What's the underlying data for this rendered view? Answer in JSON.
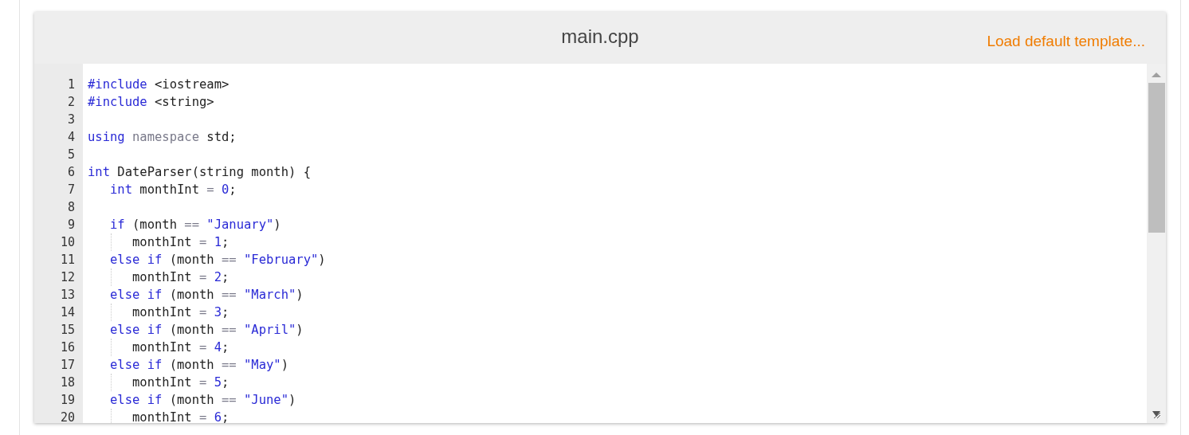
{
  "editor": {
    "title": "main.cpp",
    "template_link": "Load default template...",
    "lines": [
      {
        "number": "1",
        "guide": false,
        "tokens": [
          {
            "kind": "keyword",
            "text": "#include"
          },
          {
            "kind": "plain",
            "text": " <iostream>"
          }
        ]
      },
      {
        "number": "2",
        "guide": false,
        "tokens": [
          {
            "kind": "keyword",
            "text": "#include"
          },
          {
            "kind": "plain",
            "text": " <string>"
          }
        ]
      },
      {
        "number": "3",
        "guide": false
      },
      {
        "number": "4",
        "guide": false,
        "tokens": [
          {
            "kind": "keyword",
            "text": "using"
          },
          {
            "kind": "muted",
            "text": " namespace"
          },
          {
            "kind": "plain",
            "text": " std;"
          }
        ]
      },
      {
        "number": "5",
        "guide": false
      },
      {
        "number": "6",
        "guide": false,
        "tokens": [
          {
            "kind": "keyword",
            "text": "int"
          },
          {
            "kind": "plain",
            "text": " DateParser(string month) {"
          }
        ]
      },
      {
        "number": "7",
        "guide": false,
        "tokens": [
          {
            "kind": "keyword",
            "text": "   int"
          },
          {
            "kind": "plain",
            "text": " monthInt "
          },
          {
            "kind": "muted",
            "text": "="
          },
          {
            "kind": "literal",
            "text": " 0"
          },
          {
            "kind": "plain",
            "text": ";"
          }
        ]
      },
      {
        "number": "8",
        "guide": false
      },
      {
        "number": "9",
        "guide": false,
        "tokens": [
          {
            "kind": "keyword",
            "text": "   if"
          },
          {
            "kind": "plain",
            "text": " (month "
          },
          {
            "kind": "muted",
            "text": "=="
          },
          {
            "kind": "literal",
            "text": " \"January\""
          },
          {
            "kind": "plain",
            "text": ")"
          }
        ]
      },
      {
        "number": "10",
        "guide": true,
        "tokens": [
          {
            "kind": "plain",
            "text": "      monthInt "
          },
          {
            "kind": "muted",
            "text": "="
          },
          {
            "kind": "literal",
            "text": " 1"
          },
          {
            "kind": "plain",
            "text": ";"
          }
        ]
      },
      {
        "number": "11",
        "guide": false,
        "tokens": [
          {
            "kind": "keyword",
            "text": "   else if"
          },
          {
            "kind": "plain",
            "text": " (month "
          },
          {
            "kind": "muted",
            "text": "=="
          },
          {
            "kind": "literal",
            "text": " \"February\""
          },
          {
            "kind": "plain",
            "text": ")"
          }
        ]
      },
      {
        "number": "12",
        "guide": true,
        "tokens": [
          {
            "kind": "plain",
            "text": "      monthInt "
          },
          {
            "kind": "muted",
            "text": "="
          },
          {
            "kind": "literal",
            "text": " 2"
          },
          {
            "kind": "plain",
            "text": ";"
          }
        ]
      },
      {
        "number": "13",
        "guide": false,
        "tokens": [
          {
            "kind": "keyword",
            "text": "   else if"
          },
          {
            "kind": "plain",
            "text": " (month "
          },
          {
            "kind": "muted",
            "text": "=="
          },
          {
            "kind": "literal",
            "text": " \"March\""
          },
          {
            "kind": "plain",
            "text": ")"
          }
        ]
      },
      {
        "number": "14",
        "guide": true,
        "tokens": [
          {
            "kind": "plain",
            "text": "      monthInt "
          },
          {
            "kind": "muted",
            "text": "="
          },
          {
            "kind": "literal",
            "text": " 3"
          },
          {
            "kind": "plain",
            "text": ";"
          }
        ]
      },
      {
        "number": "15",
        "guide": false,
        "tokens": [
          {
            "kind": "keyword",
            "text": "   else if"
          },
          {
            "kind": "plain",
            "text": " (month "
          },
          {
            "kind": "muted",
            "text": "=="
          },
          {
            "kind": "literal",
            "text": " \"April\""
          },
          {
            "kind": "plain",
            "text": ")"
          }
        ]
      },
      {
        "number": "16",
        "guide": true,
        "tokens": [
          {
            "kind": "plain",
            "text": "      monthInt "
          },
          {
            "kind": "muted",
            "text": "="
          },
          {
            "kind": "literal",
            "text": " 4"
          },
          {
            "kind": "plain",
            "text": ";"
          }
        ]
      },
      {
        "number": "17",
        "guide": false,
        "tokens": [
          {
            "kind": "keyword",
            "text": "   else if"
          },
          {
            "kind": "plain",
            "text": " (month "
          },
          {
            "kind": "muted",
            "text": "=="
          },
          {
            "kind": "literal",
            "text": " \"May\""
          },
          {
            "kind": "plain",
            "text": ")"
          }
        ]
      },
      {
        "number": "18",
        "guide": true,
        "tokens": [
          {
            "kind": "plain",
            "text": "      monthInt "
          },
          {
            "kind": "muted",
            "text": "="
          },
          {
            "kind": "literal",
            "text": " 5"
          },
          {
            "kind": "plain",
            "text": ";"
          }
        ]
      },
      {
        "number": "19",
        "guide": false,
        "tokens": [
          {
            "kind": "keyword",
            "text": "   else if"
          },
          {
            "kind": "plain",
            "text": " (month "
          },
          {
            "kind": "muted",
            "text": "=="
          },
          {
            "kind": "literal",
            "text": " \"June\""
          },
          {
            "kind": "plain",
            "text": ")"
          }
        ]
      },
      {
        "number": "20",
        "guide": true,
        "tokens": [
          {
            "kind": "plain",
            "text": "      monthInt "
          },
          {
            "kind": "muted",
            "text": "="
          },
          {
            "kind": "literal",
            "text": " 6"
          },
          {
            "kind": "plain",
            "text": ";"
          }
        ]
      }
    ]
  }
}
